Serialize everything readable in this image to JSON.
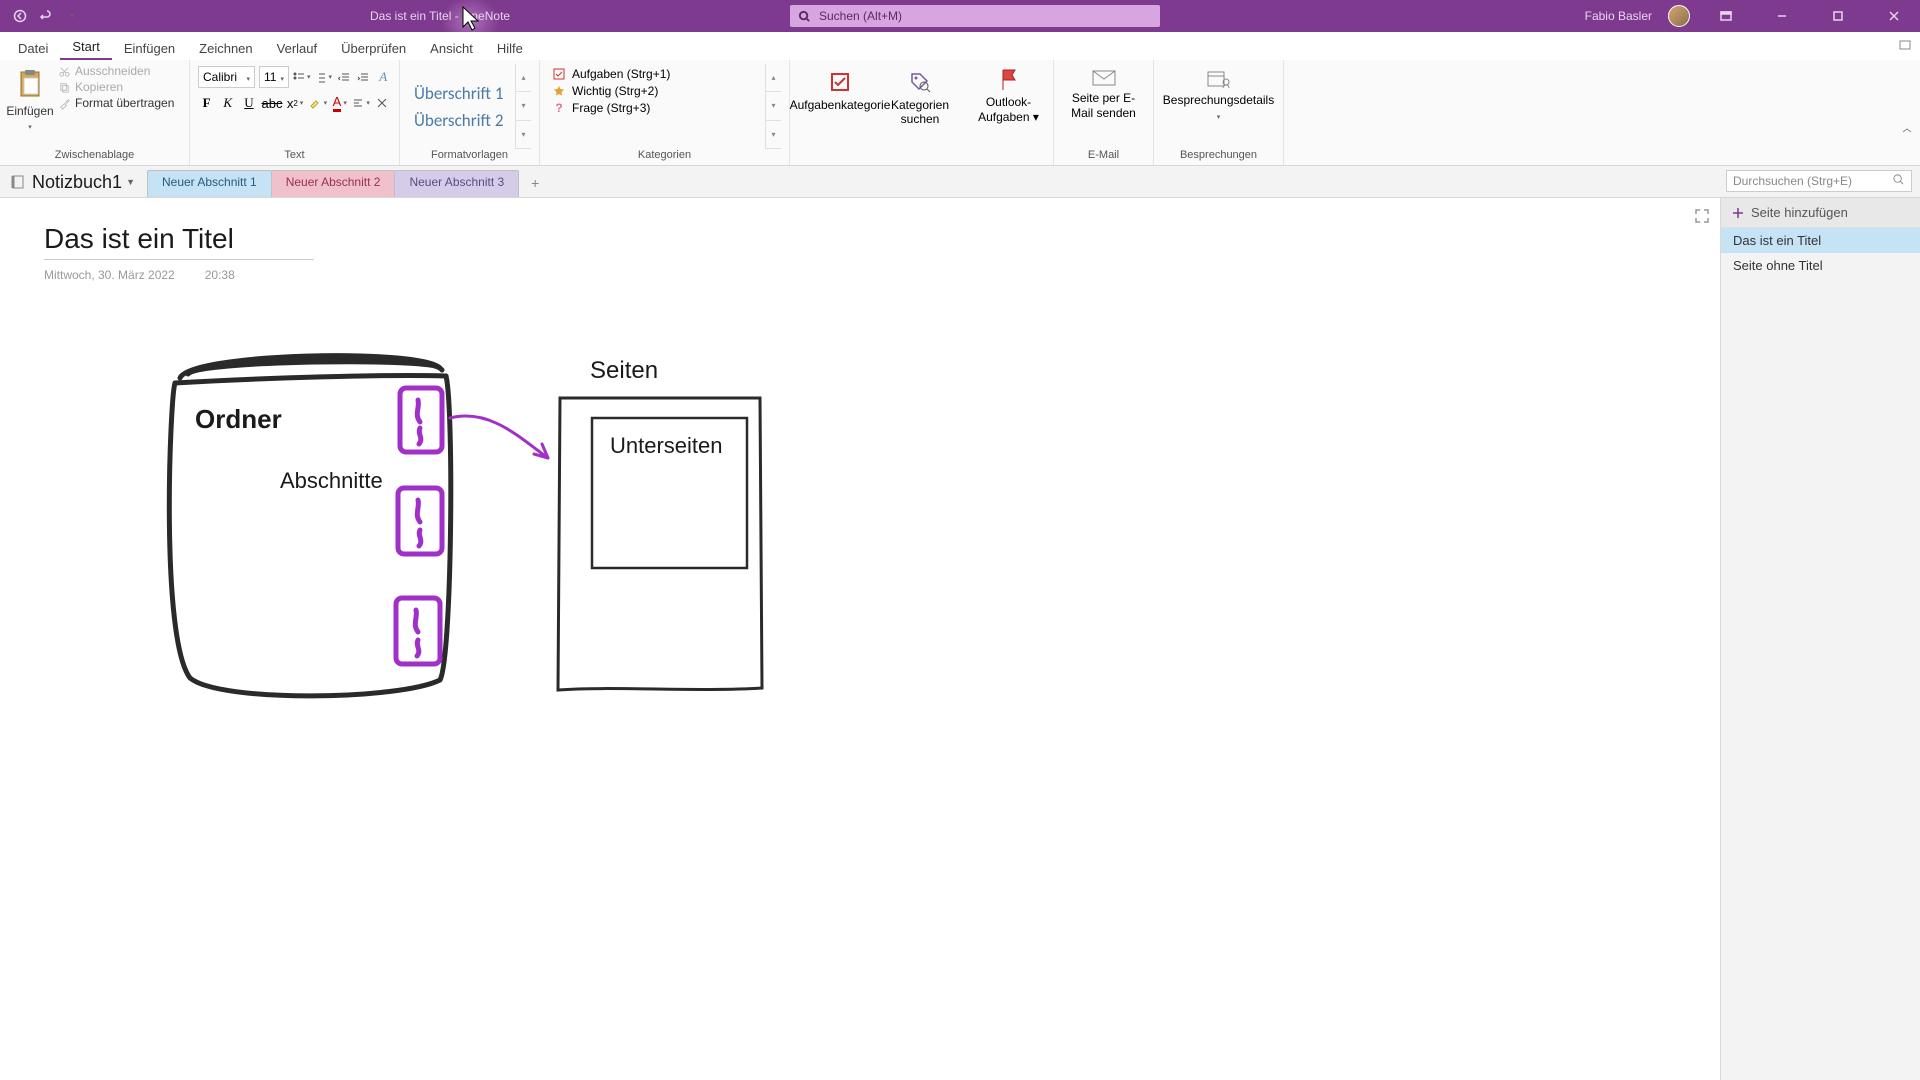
{
  "titlebar": {
    "doc_title": "Das ist ein Titel",
    "app_name": "OneNote",
    "sep": " - ",
    "search_placeholder": "Suchen (Alt+M)",
    "user_name": "Fabio Basler"
  },
  "ribbon_tabs": {
    "datei": "Datei",
    "start": "Start",
    "einfuegen": "Einfügen",
    "zeichnen": "Zeichnen",
    "verlauf": "Verlauf",
    "ueberpruefen": "Überprüfen",
    "ansicht": "Ansicht",
    "hilfe": "Hilfe"
  },
  "ribbon": {
    "clipboard": {
      "paste": "Einfügen",
      "cut": "Ausschneiden",
      "copy": "Kopieren",
      "format_painter": "Format übertragen",
      "label": "Zwischenablage"
    },
    "text": {
      "font_name": "Calibri",
      "font_size": "11",
      "label": "Text"
    },
    "styles": {
      "h1": "Überschrift 1",
      "h2": "Überschrift 2",
      "label": "Formatvorlagen"
    },
    "tags": {
      "todo": "Aufgaben (Strg+1)",
      "important": "Wichtig (Strg+2)",
      "question": "Frage (Strg+3)",
      "task_category": "Aufgabenkategorie",
      "find_tags": "Kategorien suchen",
      "label": "Kategorien"
    },
    "outlook": {
      "tasks": "Outlook-Aufgaben ▾"
    },
    "email": {
      "send": "Seite per E-Mail senden",
      "label": "E-Mail"
    },
    "meetings": {
      "details": "Besprechungsdetails",
      "label": "Besprechungen"
    }
  },
  "notebook": {
    "name": "Notizbuch1",
    "sections": {
      "s1": "Neuer Abschnitt 1",
      "s2": "Neuer Abschnitt 2",
      "s3": "Neuer Abschnitt 3"
    },
    "search_placeholder": "Durchsuchen (Strg+E)"
  },
  "page": {
    "title": "Das ist ein Titel",
    "date": "Mittwoch, 30. März 2022",
    "time": "20:38",
    "labels": {
      "ordner": "Ordner",
      "abschnitte": "Abschnitte",
      "seiten": "Seiten",
      "unterseiten": "Unterseiten"
    }
  },
  "pagepanel": {
    "add_page": "Seite hinzufügen",
    "p1": "Das ist ein Titel",
    "p2": "Seite ohne Titel"
  }
}
